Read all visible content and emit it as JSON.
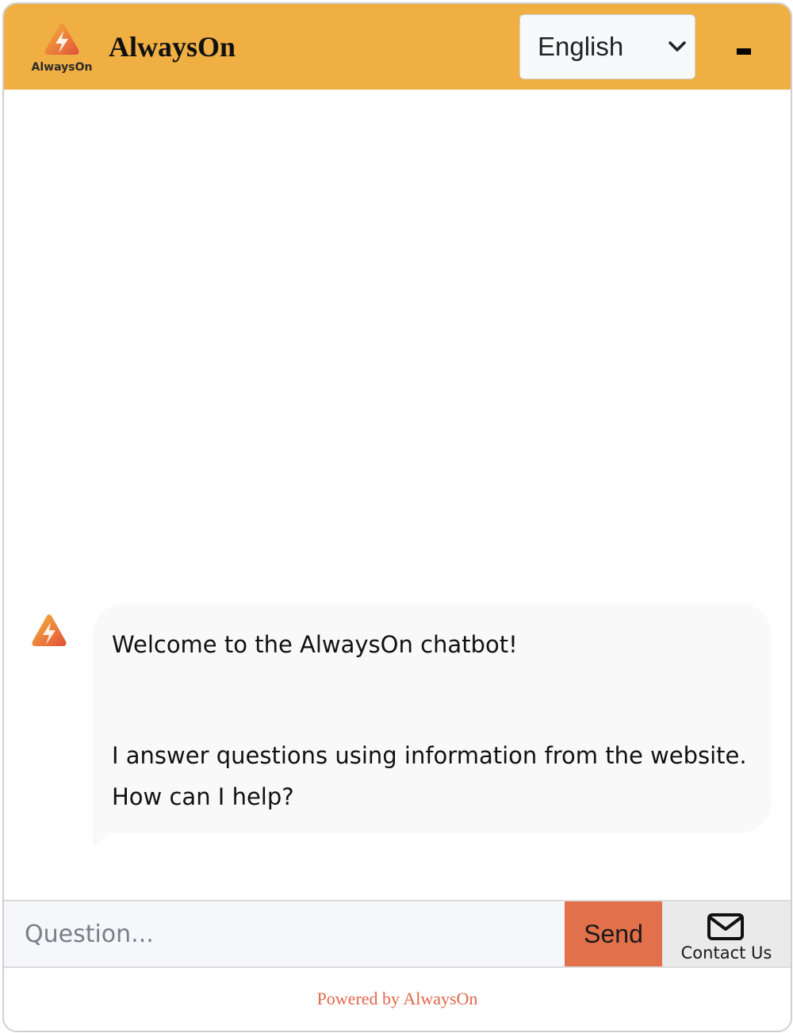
{
  "header": {
    "logo_text": "AlwaysOn",
    "title": "AlwaysOn",
    "language": {
      "selected": "English"
    },
    "minimize_icon": "minimize-icon"
  },
  "colors": {
    "header_bg": "#f0af43",
    "accent": "#e2704b",
    "bubble_bg": "#f9f9f9",
    "footer_link": "#e0674a"
  },
  "messages": [
    {
      "sender": "bot",
      "avatar_icon": "bolt-triangle-logo-icon",
      "lines": [
        "Welcome to the AlwaysOn chatbot!",
        "I answer questions using information from the website.",
        "How can I help?"
      ]
    }
  ],
  "input": {
    "placeholder": "Question...",
    "value": ""
  },
  "send_button": {
    "label": "Send"
  },
  "contact": {
    "icon": "envelope-icon",
    "label": "Contact Us"
  },
  "footer": {
    "powered_by": "Powered by AlwaysOn"
  }
}
